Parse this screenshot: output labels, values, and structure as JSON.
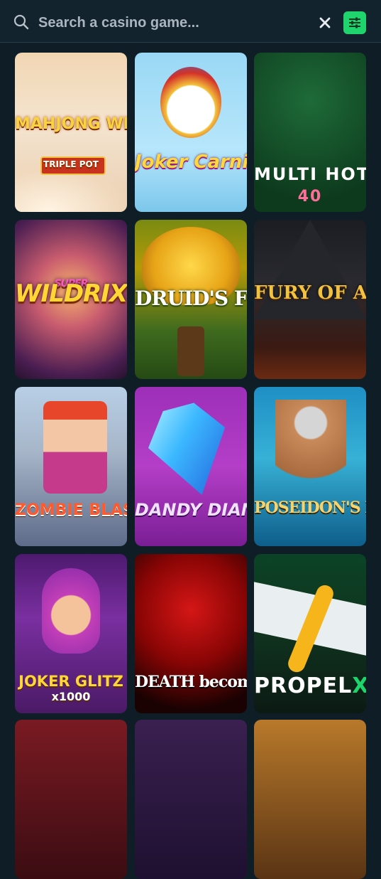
{
  "search": {
    "placeholder": "Search a casino game...",
    "value": ""
  },
  "icons": {
    "search": "search-icon",
    "clear": "close-icon",
    "filter": "filter-sliders-icon"
  },
  "colors": {
    "background": "#0f1d26",
    "search_bar": "#13232e",
    "accent": "#1fd36d"
  },
  "games": [
    {
      "title": "MAHJONG WINS",
      "subtitle": "TRIPLE POT"
    },
    {
      "title": "Joker Carnival"
    },
    {
      "title": "MULTI HOT",
      "subtitle": "40"
    },
    {
      "title": "WILDRIX",
      "subtitle": "SUPER"
    },
    {
      "title": "DRUID'S FORTUNE"
    },
    {
      "title": "FURY OF ANUBIS"
    },
    {
      "title": "ZOMBIE BLASTERS"
    },
    {
      "title": "DANDY DIAMONDS"
    },
    {
      "title": "POSEIDON'S REALM"
    },
    {
      "title": "JOKER GLITZ",
      "subtitle": "x1000"
    },
    {
      "title": "DEATH becomes YOU"
    },
    {
      "title": "PROPEL",
      "suffix": "X"
    }
  ]
}
